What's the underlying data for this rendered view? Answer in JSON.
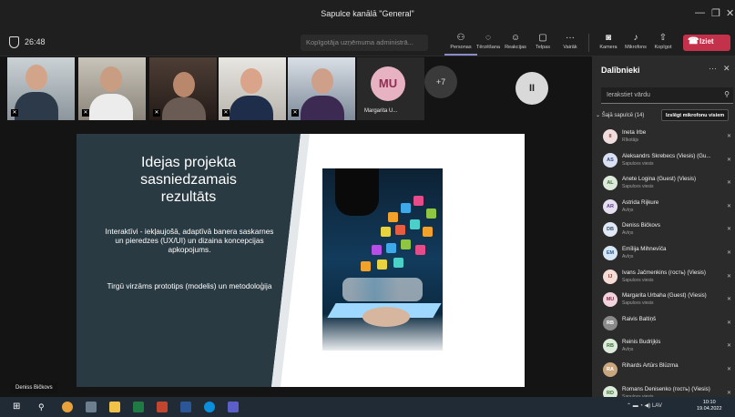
{
  "window": {
    "title": "Sapulce kanālā \"General\""
  },
  "toolbar": {
    "timer": "26:48",
    "copy_link": "Kopīgotāja uzņēmuma administrā...",
    "buttons": [
      {
        "label": "Personas",
        "icon": "people-icon"
      },
      {
        "label": "Tērzēšana",
        "icon": "chat-icon"
      },
      {
        "label": "Reakcijas",
        "icon": "reactions-icon"
      },
      {
        "label": "Telpas",
        "icon": "rooms-icon"
      },
      {
        "label": "Vairāk",
        "icon": "more-icon"
      },
      {
        "label": "Kamera",
        "icon": "camera-off-icon"
      },
      {
        "label": "Mikrofons",
        "icon": "mic-off-icon"
      },
      {
        "label": "Kopīgot",
        "icon": "share-icon"
      }
    ],
    "leave": "Iziet"
  },
  "strip": {
    "mu_initials": "MU",
    "mu_name": "Margarita U...",
    "more_count": "+7"
  },
  "slide": {
    "title": "Idejas projekta\nsasniedzamais\nrezultāts",
    "body1": "Interaktīvi - iekļaujošā, adaptīvā banera saskarnes un pieredzes (UX/UI) un dizaina koncepcijas apkopojums.",
    "body2": "Tirgū virzāms prototips (modelis) un metodoloģija"
  },
  "presenter_caption": "Deniss Bičkovs",
  "panel": {
    "title": "Dalībnieki",
    "search_placeholder": "Ierakstiet vārdu",
    "group_label": "Šajā sapulcē (14)",
    "mute_all": "Izslēgt mikrofonu visiem",
    "participants": [
      {
        "initials": "II",
        "name": "Ineta Irbe",
        "role": "Rīkotājs",
        "bg": "#f0dede",
        "fg": "#8a3b3b"
      },
      {
        "initials": "AS",
        "name": "Aleksandrs Skrebecs (Viesis) (Gu...",
        "role": "Sapulces viesis",
        "bg": "#d9e0f2",
        "fg": "#3a4a80"
      },
      {
        "initials": "AL",
        "name": "Anete Logina (Guest) (Viesis)",
        "role": "Sapulces viesis",
        "bg": "#dcebd9",
        "fg": "#3c6b35"
      },
      {
        "initials": "AR",
        "name": "Astrida Rijkure",
        "role": "Avīņs",
        "bg": "#e6dff0",
        "fg": "#5b3f86"
      },
      {
        "initials": "DB",
        "name": "Deniss Bičkovs",
        "role": "Avīņs",
        "bg": "#e0e8f3",
        "fg": "#36506f"
      },
      {
        "initials": "EM",
        "name": "Emīlija Mihnevīča",
        "role": "Avīņs",
        "bg": "#d6e6f5",
        "fg": "#2d5b8a"
      },
      {
        "initials": "IJ",
        "name": "Ivans Jačmenkins (гость) (Viesis)",
        "role": "Sapulces viesis",
        "bg": "#f5dcd6",
        "fg": "#8a4030"
      },
      {
        "initials": "MU",
        "name": "Margarita Urbaha (Guest) (Viesis)",
        "role": "Sapulces viesis",
        "bg": "#f2d3de",
        "fg": "#8f2d52"
      },
      {
        "initials": "RB",
        "name": "Raivis Baltiņš",
        "role": "",
        "bg": "#8a8a8a",
        "fg": "#ffffff"
      },
      {
        "initials": "RB",
        "name": "Reinis Budrijķis",
        "role": "Avīņs",
        "bg": "#dcebd9",
        "fg": "#3c6b35"
      },
      {
        "initials": "RA",
        "name": "Rihards Artūrs Blūzma",
        "role": "",
        "bg": "#c9a67e",
        "fg": "#ffffff"
      },
      {
        "initials": "RD",
        "name": "Romans Denisenko (гость) (Viesis)",
        "role": "Sapulces viesis",
        "bg": "#dcebd9",
        "fg": "#3c6b35"
      }
    ]
  },
  "taskbar": {
    "lang": "LAV",
    "time": "10:10",
    "date": "19.04.2022"
  }
}
